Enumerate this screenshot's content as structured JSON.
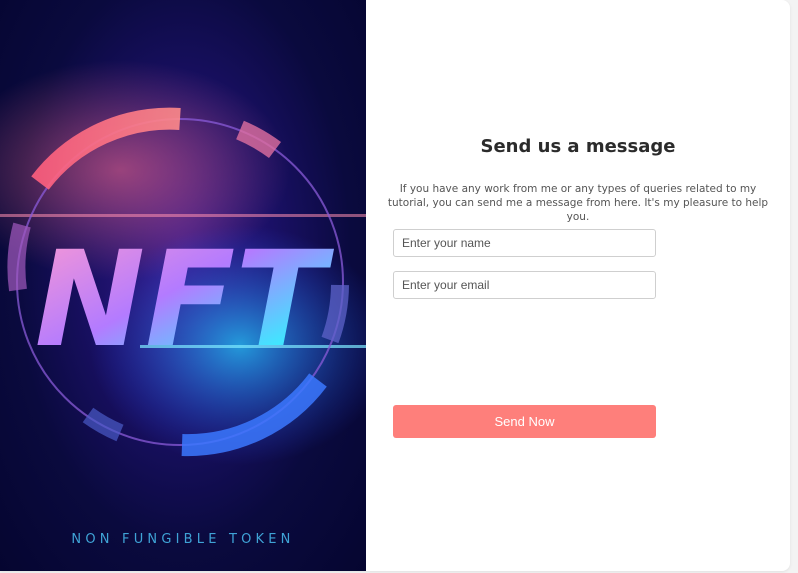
{
  "hero": {
    "logo_text": "NFT",
    "caption": "NON FUNGIBLE TOKEN"
  },
  "form": {
    "title": "Send us a message",
    "description": "If you have any work from me or any types of queries related to my tutorial, you can send me a message from here. It's my pleasure to help you.",
    "name_placeholder": "Enter your name",
    "email_placeholder": "Enter your email",
    "submit_label": "Send Now"
  },
  "colors": {
    "accent": "#fe7f7b",
    "hero_bg": "#0a0a3e",
    "caption": "#3fa3d6"
  }
}
